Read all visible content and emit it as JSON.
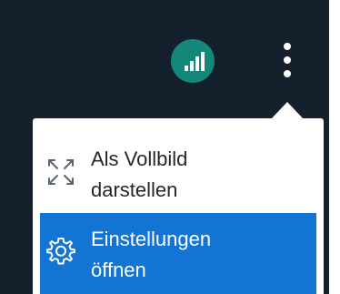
{
  "colors": {
    "background": "#14202b",
    "signal_button": "#14877b",
    "menu_bg": "#ffffff",
    "menu_highlight": "#1474d3",
    "text_dark": "#22272d",
    "text_light": "#ffffff"
  },
  "header": {
    "signal_icon": "signal-bars-icon",
    "more_icon": "more-vertical-icon"
  },
  "menu": {
    "items": [
      {
        "icon": "fullscreen-expand-icon",
        "line1": "Als Vollbild",
        "line2": "darstellen",
        "highlighted": false
      },
      {
        "icon": "gear-icon",
        "line1": "Einstellungen",
        "line2": "öffnen",
        "highlighted": true
      }
    ]
  }
}
